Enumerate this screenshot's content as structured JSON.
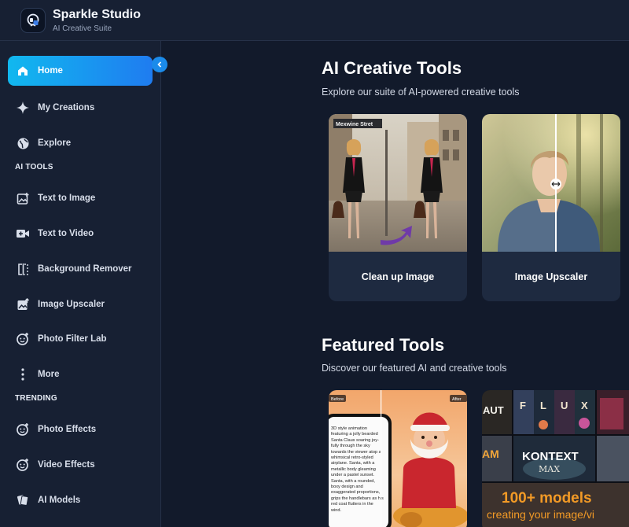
{
  "app": {
    "title": "Sparkle Studio",
    "subtitle": "AI Creative Suite"
  },
  "sidebar": {
    "items": [
      {
        "label": "Home",
        "icon": "home-icon",
        "active": true
      },
      {
        "label": "My Creations",
        "icon": "sparkle-icon"
      },
      {
        "label": "Explore",
        "icon": "globe-icon"
      }
    ],
    "ai_tools_label": "AI TOOLS",
    "ai_tools": [
      {
        "label": "Text to Image",
        "icon": "image-plus-icon"
      },
      {
        "label": "Text to Video",
        "icon": "video-plus-icon"
      },
      {
        "label": "Background Remover",
        "icon": "compare-icon"
      },
      {
        "label": "Image Upscaler",
        "icon": "image-up-icon"
      },
      {
        "label": "Photo Filter Lab",
        "icon": "filter-face-icon"
      },
      {
        "label": "More",
        "icon": "more-dots-icon"
      }
    ],
    "trending_label": "TRENDING",
    "trending": [
      {
        "label": "Photo Effects",
        "icon": "effects-face-icon"
      },
      {
        "label": "Video Effects",
        "icon": "video-effects-icon"
      },
      {
        "label": "AI Models",
        "icon": "cards-icon"
      }
    ]
  },
  "main": {
    "creative_tools": {
      "title": "AI Creative Tools",
      "subtitle": "Explore our suite of AI-powered creative tools",
      "cards": [
        {
          "label": "Clean up Image",
          "street_sign": "Mexwine Stret"
        },
        {
          "label": "Image Upscaler"
        }
      ]
    },
    "featured": {
      "title": "Featured Tools",
      "subtitle": "Discover our featured AI and creative tools",
      "card1": {
        "before": "Before",
        "after": "After",
        "phone_text": "3D style animation featuring a jolly bearded Santa Claus soaring joy-fully through the sky towards the viewer atop a whimsical retro-styled airplane. Santa, with a metallic body gleaming under a pastel sunset. Santa, with a rounded, boxy design and exaggerated proportions, grips the handlebars as his red coat flutters in the wind."
      },
      "card2": {
        "kontext": "KONTEXT",
        "max": "MAX",
        "flux": [
          "F",
          "L",
          "U",
          "X"
        ],
        "aut": "AUT",
        "models": "100+ models",
        "tagline": "creating your image/vi"
      }
    }
  },
  "colors": {
    "accent_start": "#11b8ef",
    "accent_end": "#1f7cf0",
    "bg": "#121a2b",
    "panel": "#172033",
    "card": "#1e2a40"
  }
}
